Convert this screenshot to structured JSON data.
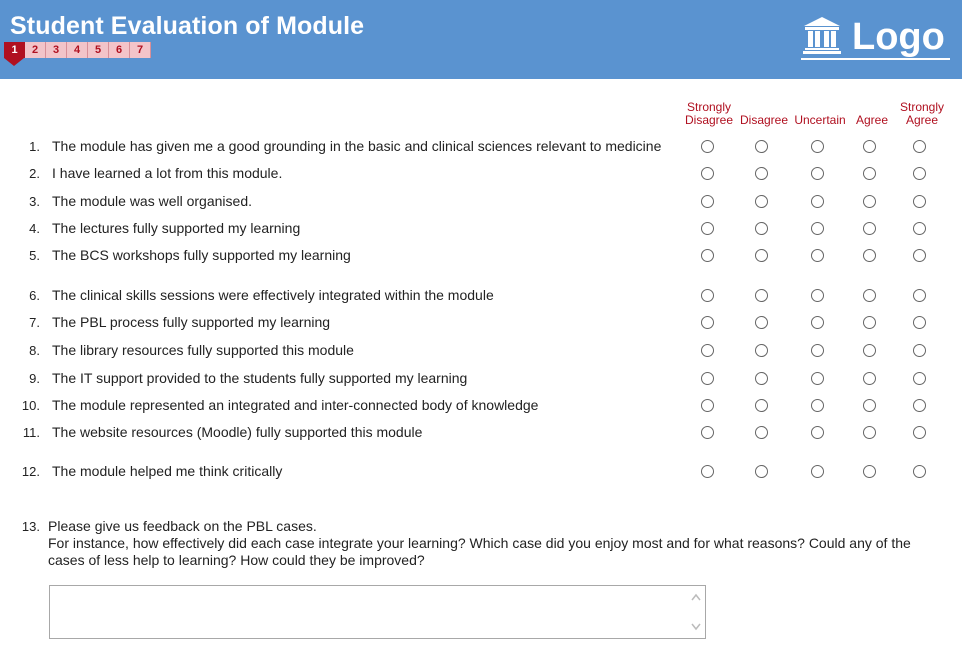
{
  "header": {
    "title": "Student Evaluation of Module",
    "pages": [
      "1",
      "2",
      "3",
      "4",
      "5",
      "6",
      "7"
    ],
    "active_page": "1",
    "logo_text": "Logo"
  },
  "scale": {
    "columns": [
      {
        "line1": "Strongly",
        "line2": "Disagree"
      },
      {
        "line1": "",
        "line2": "Disagree"
      },
      {
        "line1": "",
        "line2": "Uncertain"
      },
      {
        "line1": "",
        "line2": "Agree"
      },
      {
        "line1": "Strongly",
        "line2": "Agree"
      }
    ]
  },
  "questions": [
    {
      "num": "1.",
      "text": "The module has given me a good grounding in the basic and clinical sciences relevant to medicine"
    },
    {
      "num": "2.",
      "text": "I have learned a lot from this module."
    },
    {
      "num": "3.",
      "text": "The module was well organised."
    },
    {
      "num": "4.",
      "text": "The lectures fully supported my learning"
    },
    {
      "num": "5.",
      "text": "The BCS workshops fully supported my learning"
    },
    {
      "num": "6.",
      "text": "The clinical skills sessions were effectively integrated within the module"
    },
    {
      "num": "7.",
      "text": "The PBL process fully supported my learning"
    },
    {
      "num": "8.",
      "text": "The library resources fully supported this module"
    },
    {
      "num": "9.",
      "text": "The IT support provided to the students fully supported my learning"
    },
    {
      "num": "10.",
      "text": "The module represented an integrated and inter-connected body of knowledge"
    },
    {
      "num": "11.",
      "text": "The website resources (Moodle) fully supported this module"
    },
    {
      "num": "12.",
      "text": "The module helped me think critically"
    }
  ],
  "feedback": {
    "num": "13.",
    "line1": "Please give us feedback on the PBL cases.",
    "line2": "For instance, how effectively did each case integrate your learning? Which case did you enjoy most and for what reasons? Could any of the",
    "line3": "cases of less help to learning? How could they be improved?",
    "value": ""
  },
  "colors": {
    "header_bg": "#5a93d0",
    "accent_red": "#b01020",
    "page_tab_bg": "#f3c4c9"
  },
  "icons": {
    "logo": "bank-building-icon",
    "scroll_up": "chevron-up-icon",
    "scroll_down": "chevron-down-icon"
  }
}
